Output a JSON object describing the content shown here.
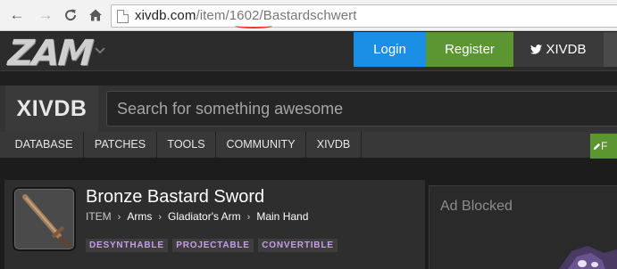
{
  "browser": {
    "url_host": "xivdb.com",
    "url_path_a": "/item/",
    "url_path_id": "1602",
    "url_path_b": "/Bastardschwert"
  },
  "zam": {
    "logo": "ZAM",
    "caret": "⌄",
    "login_label": "Login",
    "register_label": "Register",
    "xivdb_label": "XIVDB"
  },
  "xivdb": {
    "logo": "XIVDB",
    "search_placeholder": "Search for something awesome"
  },
  "nav": {
    "items": [
      {
        "label": "DATABASE"
      },
      {
        "label": "PATCHES"
      },
      {
        "label": "TOOLS"
      },
      {
        "label": "COMMUNITY"
      },
      {
        "label": "XIVDB"
      }
    ],
    "extra_label": "F"
  },
  "item": {
    "name": "Bronze Bastard Sword",
    "breadcrumb": {
      "type": "ITEM",
      "arms": "Arms",
      "class": "Gladiator's Arm",
      "slot": "Main Hand"
    },
    "tags": [
      "DESYNTHABLE",
      "PROJECTABLE",
      "CONVERTIBLE"
    ]
  },
  "ad": {
    "text": "Ad Blocked"
  },
  "colors": {
    "login": "#1b8ee6",
    "register": "#5b9633",
    "tag_text": "#c79ce8",
    "url_underline": "#e53935"
  },
  "icons": [
    "back-arrow-icon",
    "forward-arrow-icon",
    "reload-icon",
    "home-icon",
    "page-icon",
    "twitter-bird-icon",
    "pencil-icon",
    "sword-icon",
    "chevron-right-icon"
  ]
}
